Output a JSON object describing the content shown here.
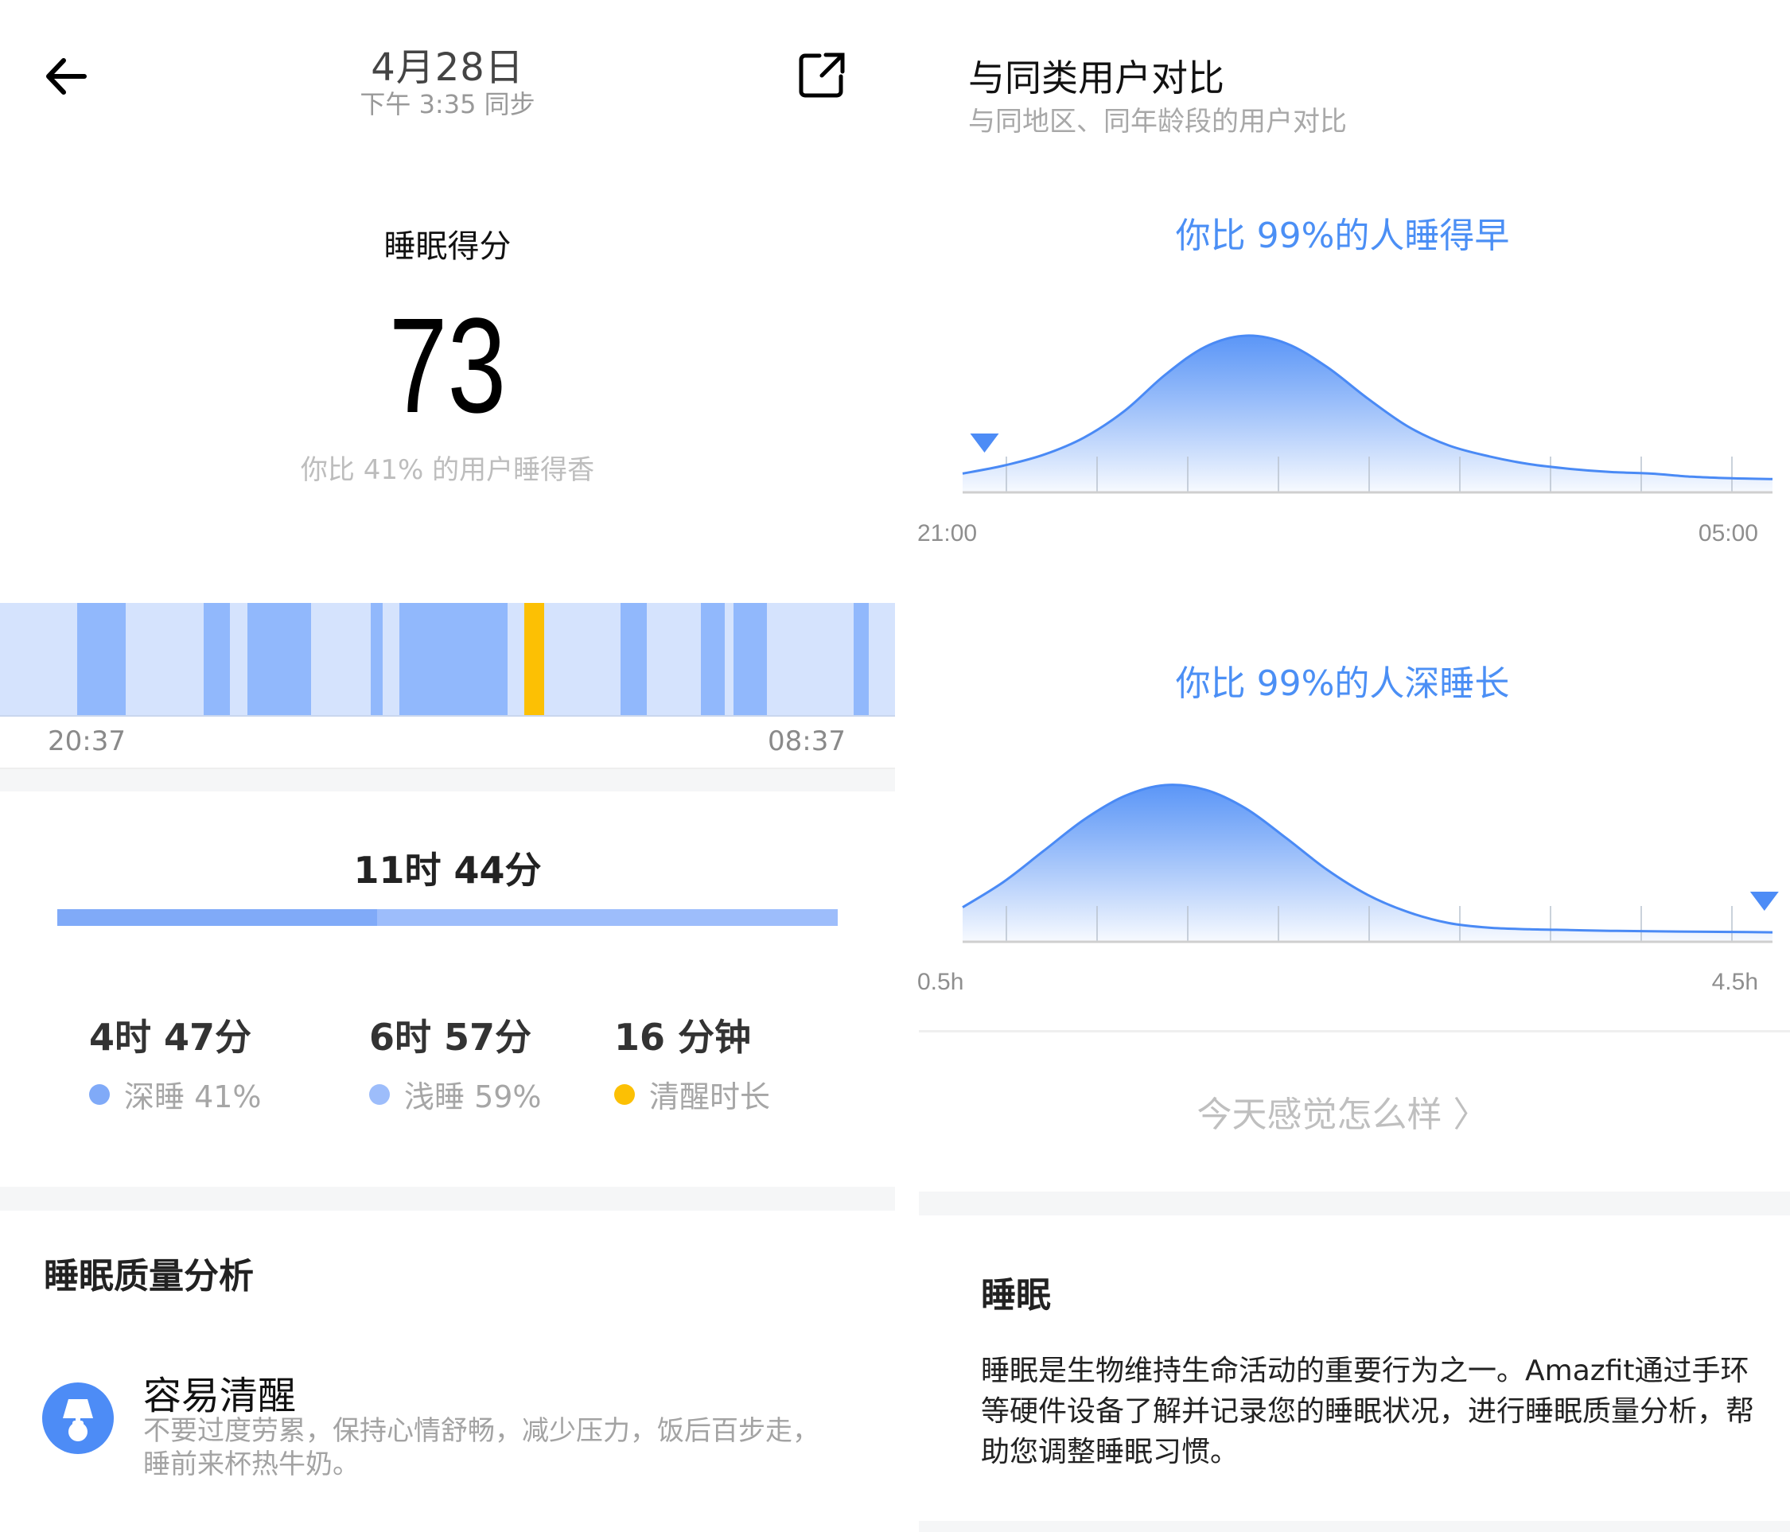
{
  "header": {
    "date": "4月28日",
    "sync": "下午 3:35 同步",
    "back_icon": "arrow-left-icon",
    "share_icon": "share-external-icon"
  },
  "score": {
    "label": "睡眠得分",
    "value": "73",
    "compare_text": "你比 41% 的用户睡得香"
  },
  "timeline": {
    "start_label": "20:37",
    "end_label": "08:37",
    "total_minutes": 720,
    "colors": {
      "light": "#d5e3fd",
      "deep": "#91b8fc",
      "awake": "#fcc004"
    },
    "segments": [
      {
        "type": "deep",
        "start": 62,
        "end": 101
      },
      {
        "type": "deep",
        "start": 164,
        "end": 185
      },
      {
        "type": "deep",
        "start": 199,
        "end": 250
      },
      {
        "type": "deep",
        "start": 298,
        "end": 308
      },
      {
        "type": "deep",
        "start": 321,
        "end": 408
      },
      {
        "type": "awake",
        "start": 422,
        "end": 438
      },
      {
        "type": "deep",
        "start": 499,
        "end": 520
      },
      {
        "type": "deep",
        "start": 564,
        "end": 583
      },
      {
        "type": "deep",
        "start": 590,
        "end": 617
      },
      {
        "type": "deep",
        "start": 687,
        "end": 699
      }
    ]
  },
  "summary": {
    "total": "11时 44分",
    "deep_fraction": 0.41,
    "stats": [
      {
        "value": "4时 47分",
        "label": "深睡 41%",
        "color": "#80aaf8"
      },
      {
        "value": "6时 57分",
        "label": "浅睡 59%",
        "color": "#9dbdfb"
      },
      {
        "value": "16 分钟",
        "label": "清醒时长",
        "color": "#fcc004"
      }
    ]
  },
  "analysis": {
    "title": "睡眠质量分析",
    "icon": "lamp-icon",
    "item_title": "容易清醒",
    "item_desc": "不要过度劳累，保持心情舒畅，减少压力，饭后百步走，睡前来杯热牛奶。"
  },
  "comparison": {
    "title": "与同类用户对比",
    "subtitle": "与同地区、同年龄段的用户对比"
  },
  "chart_data": [
    {
      "type": "area",
      "title": "你比 99%的人睡得早",
      "xlabel": "",
      "ylabel": "",
      "x_tick_labels": [
        "21:00",
        "05:00"
      ],
      "x_range_hours": [
        20.75,
        29.7
      ],
      "distribution": "right-skewed bell, peak ≈ 23:15",
      "x": [
        0,
        0.05,
        0.1,
        0.15,
        0.2,
        0.25,
        0.3,
        0.35,
        0.4,
        0.45,
        0.5,
        0.55,
        0.6,
        0.65,
        0.7,
        0.75,
        0.8,
        0.85,
        0.9,
        0.95,
        1
      ],
      "y": [
        0.12,
        0.17,
        0.24,
        0.35,
        0.52,
        0.75,
        0.93,
        1.0,
        0.95,
        0.8,
        0.6,
        0.42,
        0.3,
        0.23,
        0.18,
        0.15,
        0.13,
        0.12,
        0.1,
        0.09,
        0.085
      ],
      "marker": {
        "x": 0.027,
        "label": "you"
      },
      "grid": true,
      "tick_count": 9
    },
    {
      "type": "area",
      "title": "你比 99%的人深睡长",
      "xlabel": "",
      "ylabel": "",
      "x_tick_labels": [
        "0.5h",
        "4.5h"
      ],
      "distribution": "bell, peak ≈ 1.5h",
      "x": [
        0,
        0.05,
        0.1,
        0.15,
        0.2,
        0.25,
        0.3,
        0.35,
        0.4,
        0.45,
        0.5,
        0.55,
        0.6,
        0.65,
        0.7,
        0.75,
        0.8,
        0.85,
        0.9,
        0.95,
        1
      ],
      "y": [
        0.22,
        0.38,
        0.58,
        0.78,
        0.93,
        1.0,
        0.97,
        0.85,
        0.66,
        0.46,
        0.3,
        0.19,
        0.12,
        0.09,
        0.08,
        0.075,
        0.07,
        0.067,
        0.065,
        0.063,
        0.06
      ],
      "marker": {
        "x": 0.99,
        "label": "you"
      },
      "grid": true,
      "tick_count": 9
    }
  ],
  "feeling_link": "今天感觉怎么样 〉",
  "info": {
    "title": "睡眠",
    "body": "睡眠是生物维持生命活动的重要行为之一。Amazfit通过手环等硬件设备了解并记录您的睡眠状况，进行睡眠质量分析，帮助您调整睡眠习惯。"
  }
}
